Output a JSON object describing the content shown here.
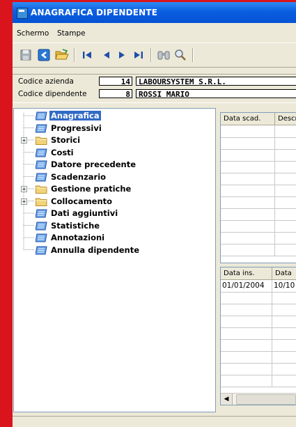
{
  "window": {
    "title": "ANAGRAFICA DIPENDENTE"
  },
  "menu": {
    "items": [
      "Schermo",
      "Stampe"
    ]
  },
  "toolbar": {
    "buttons": [
      "save-icon",
      "exit-icon",
      "open-folder-icon",
      "first-record-icon",
      "previous-record-icon",
      "next-record-icon",
      "last-record-icon",
      "binoculars-icon",
      "search-icon"
    ]
  },
  "header": {
    "company_label": "Codice azienda",
    "company_code": "14",
    "company_name": "LABOURSYSTEM S.R.L.",
    "employee_label": "Codice dipendente",
    "employee_code": "8",
    "employee_name": "ROSSI MARIO"
  },
  "tree": {
    "items": [
      {
        "label": "Anagrafica",
        "type": "doc",
        "selected": true
      },
      {
        "label": "Progressivi",
        "type": "doc"
      },
      {
        "label": "Storici",
        "type": "folder"
      },
      {
        "label": "Costi",
        "type": "doc"
      },
      {
        "label": "Datore precedente",
        "type": "doc"
      },
      {
        "label": "Scadenzario",
        "type": "doc"
      },
      {
        "label": "Gestione pratiche",
        "type": "folder"
      },
      {
        "label": "Collocamento",
        "type": "folder"
      },
      {
        "label": "Dati aggiuntivi",
        "type": "doc"
      },
      {
        "label": "Statistiche",
        "type": "doc"
      },
      {
        "label": "Annotazioni",
        "type": "doc"
      },
      {
        "label": "Annulla dipendente",
        "type": "doc"
      }
    ]
  },
  "grid1": {
    "columns": [
      "Data scad.",
      "Descr"
    ],
    "rows": []
  },
  "grid2": {
    "columns": [
      "Data ins.",
      "Data"
    ],
    "rows": [
      [
        "01/01/2004",
        "10/10"
      ]
    ]
  },
  "colors": {
    "titlebar": "#0a5ee0",
    "selection": "#316ac5",
    "background": "#d9141c",
    "panel": "#ece9d8"
  }
}
